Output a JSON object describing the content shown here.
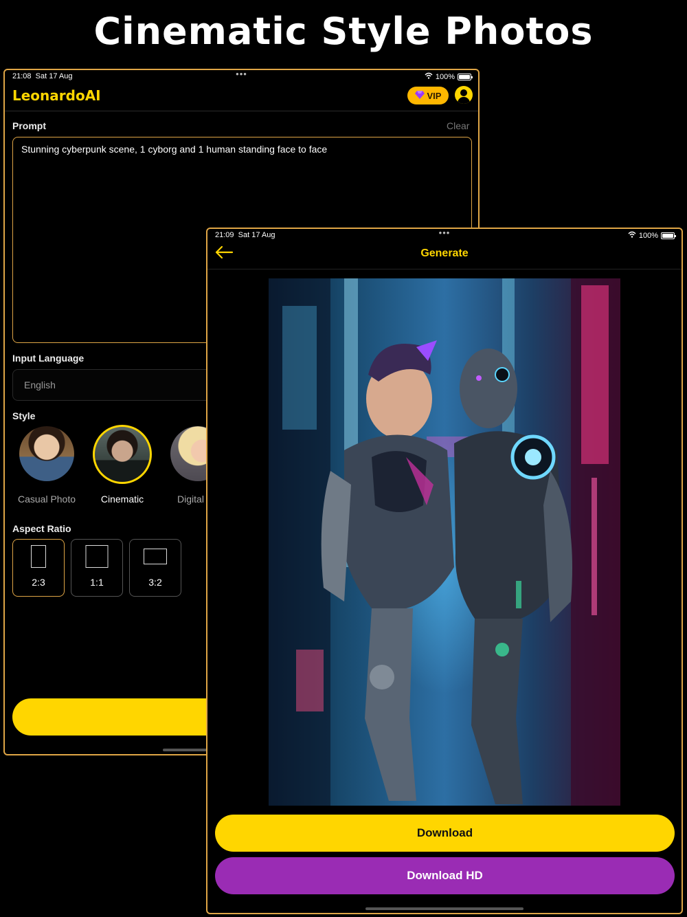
{
  "headline": "Cinematic Style Photos",
  "back_screen": {
    "status": {
      "time": "21:08",
      "date": "Sat 17 Aug",
      "dots": "•••",
      "battery": "100%"
    },
    "app_title": "LeonardoAI",
    "vip_label": "VIP",
    "prompt": {
      "label": "Prompt",
      "clear_label": "Clear",
      "value": "Stunning cyberpunk scene, 1 cyborg and 1 human standing face to face"
    },
    "input_language": {
      "label": "Input Language",
      "value": "English"
    },
    "style": {
      "label": "Style",
      "items": [
        {
          "label": "Casual Photo",
          "selected": false
        },
        {
          "label": "Cinematic",
          "selected": true
        },
        {
          "label": "Digital Pa",
          "selected": false
        }
      ]
    },
    "aspect_ratio": {
      "label": "Aspect Ratio",
      "options": [
        {
          "label": "2:3",
          "selected": true
        },
        {
          "label": "1:1",
          "selected": false
        },
        {
          "label": "3:2",
          "selected": false
        }
      ]
    }
  },
  "front_screen": {
    "status": {
      "time": "21:09",
      "date": "Sat 17 Aug",
      "dots": "•••",
      "battery": "100%"
    },
    "title": "Generate",
    "download_label": "Download",
    "download_hd_label": "Download HD"
  },
  "colors": {
    "accent_yellow": "#ffd600",
    "frame_orange": "#e0a646",
    "hd_purple": "#9a2cb4",
    "background": "#000000"
  }
}
